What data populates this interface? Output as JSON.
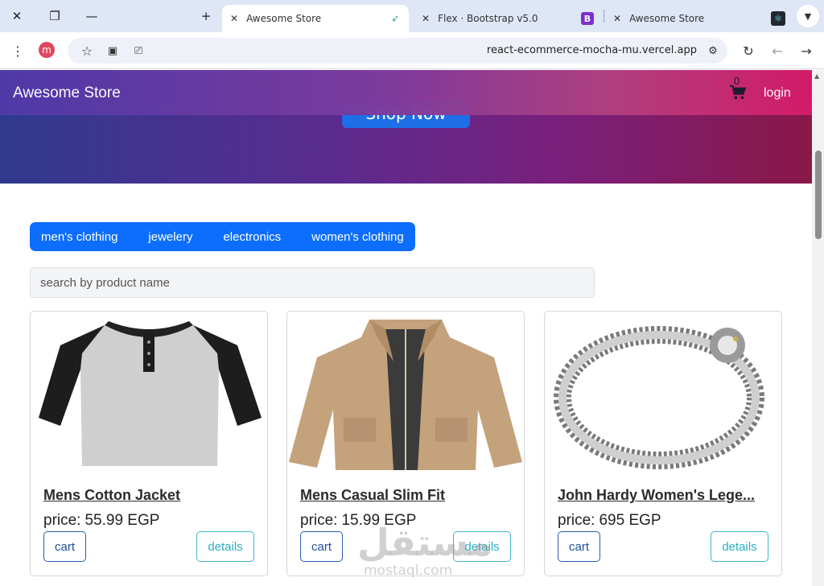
{
  "browser": {
    "tabs": [
      {
        "label": "Awesome Store",
        "active": true
      },
      {
        "label": "Flex · Bootstrap v5.0",
        "active": false
      },
      {
        "label": "Awesome Store",
        "active": false
      }
    ],
    "url": "react-ecommerce-mocha-mu.vercel.app",
    "avatar_letter": "m"
  },
  "navbar": {
    "brand": "Awesome Store",
    "cart_count": "0",
    "login": "login"
  },
  "hero": {
    "button": "Shop Now"
  },
  "categories": [
    "men's clothing",
    "jewelery",
    "electronics",
    "women's clothing"
  ],
  "search": {
    "placeholder": "search by product name"
  },
  "products": [
    {
      "title": "Mens Cotton Jacket",
      "price_label": "price:",
      "price": "55.99 EGP",
      "cart": "cart",
      "details": "details"
    },
    {
      "title": "Mens Casual Slim Fit",
      "price_label": "price:",
      "price": "15.99 EGP",
      "cart": "cart",
      "details": "details"
    },
    {
      "title": "John Hardy Women's Lege...",
      "price_label": "price:",
      "price": "695 EGP",
      "cart": "cart",
      "details": "details"
    }
  ],
  "watermark": {
    "logo": "مستقل",
    "site": "mostaql.com"
  },
  "colors": {
    "primary": "#0d6efd",
    "navbar_start": "#4f3aa8",
    "navbar_end": "#d61b6a",
    "info": "#2bb0c4"
  }
}
